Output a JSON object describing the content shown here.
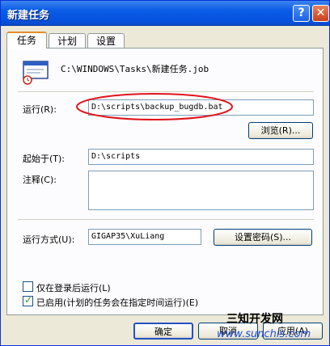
{
  "window": {
    "title": "新建任务",
    "help_glyph": "?",
    "close_glyph": "✕"
  },
  "tabs": [
    {
      "label": "任务",
      "active": true
    },
    {
      "label": "计划",
      "active": false
    },
    {
      "label": "设置",
      "active": false
    }
  ],
  "task": {
    "file_path": "C:\\WINDOWS\\Tasks\\新建任务.job",
    "run_label": "运行(R):",
    "run_value": "D:\\scripts\\backup_bugdb.bat",
    "browse_label": "浏览(R)...",
    "start_in_label": "起始于(T):",
    "start_in_value": "D:\\scripts",
    "comment_label": "注释(C):",
    "comment_value": "",
    "run_as_label": "运行方式(U):",
    "run_as_value": "GIGAP35\\XuLiang",
    "set_password_label": "设置密码(S)...",
    "only_logged_on_label": "仅在登录后运行(L)",
    "only_logged_on_checked": false,
    "enabled_label": "已启用(计划的任务会在指定时间运行)(E)",
    "enabled_checked": true
  },
  "footer": {
    "ok_label": "确定",
    "cancel_label": "取消",
    "apply_label": "应用(A)"
  },
  "watermark": {
    "brand": "三知开发网",
    "url": "www.sunchis.com"
  },
  "colors": {
    "titlebar": "#0a5ce6",
    "highlight_oval": "#e0141c",
    "tab_accent": "#e68b2c"
  }
}
